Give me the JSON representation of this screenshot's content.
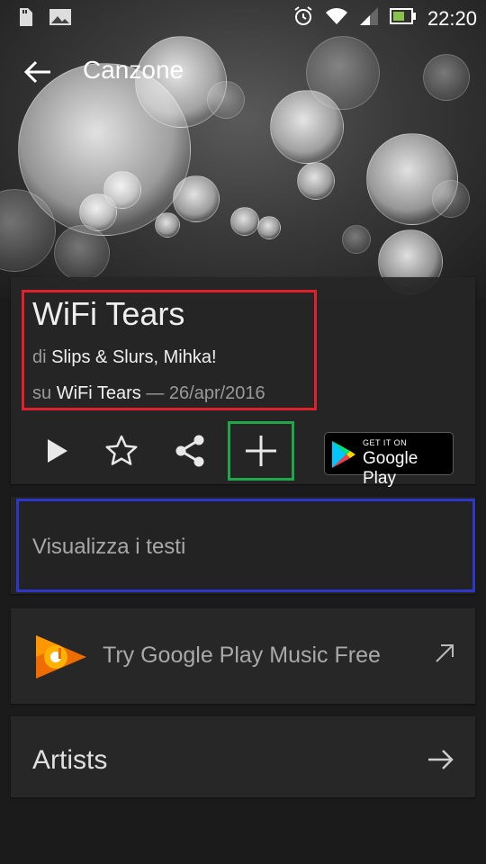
{
  "status_bar": {
    "time": "22:20",
    "icons": [
      "sd-card-icon",
      "image-icon",
      "alarm-icon",
      "wifi-icon",
      "signal-icon",
      "battery-icon"
    ]
  },
  "app_bar": {
    "title": "Canzone",
    "back_icon": "arrow-back-icon"
  },
  "song": {
    "title": "WiFi Tears",
    "by_prefix": "di",
    "artists": "Slips & Slurs, Mihka!",
    "on_prefix": "su",
    "album": "WiFi Tears",
    "date_separator": "—",
    "date": "26/apr/2016"
  },
  "actions": {
    "icons": [
      "play-icon",
      "star-icon",
      "share-icon",
      "plus-icon"
    ],
    "google_play": {
      "small_text": "GET IT ON",
      "big_text": "Google Play"
    }
  },
  "lyrics": {
    "label": "Visualizza i testi"
  },
  "promo": {
    "label": "Try Google Play Music Free"
  },
  "artists_section": {
    "label": "Artists"
  },
  "colors": {
    "highlight_red": "#e0202a",
    "highlight_green": "#1fa84a",
    "highlight_blue": "#2e35c9",
    "card_bg": "#272727",
    "page_bg": "#1b1b1b"
  }
}
